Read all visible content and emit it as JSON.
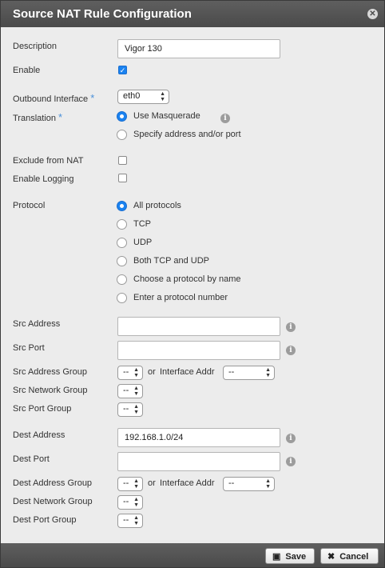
{
  "dialog": {
    "title": "Source NAT Rule Configuration",
    "close_icon": "close-icon"
  },
  "fields": {
    "description": {
      "label": "Description",
      "value": "Vigor 130"
    },
    "enable": {
      "label": "Enable",
      "checked": true
    },
    "outbound_interface": {
      "label": "Outbound Interface",
      "value": "eth0"
    },
    "translation": {
      "label": "Translation",
      "options": [
        "Use Masquerade",
        "Specify address and/or port"
      ],
      "selected": "Use Masquerade"
    },
    "exclude_from_nat": {
      "label": "Exclude from NAT",
      "checked": false
    },
    "enable_logging": {
      "label": "Enable Logging",
      "checked": false
    },
    "protocol": {
      "label": "Protocol",
      "options": [
        "All protocols",
        "TCP",
        "UDP",
        "Both TCP and UDP",
        "Choose a protocol by name",
        "Enter a protocol number"
      ],
      "selected": "All protocols"
    },
    "src_address": {
      "label": "Src Address",
      "value": ""
    },
    "src_port": {
      "label": "Src Port",
      "value": ""
    },
    "src_address_group": {
      "label": "Src Address Group",
      "value": "--",
      "or": "or",
      "iface_label": "Interface Addr",
      "iface_value": "--"
    },
    "src_network_group": {
      "label": "Src Network Group",
      "value": "--"
    },
    "src_port_group": {
      "label": "Src Port Group",
      "value": "--"
    },
    "dest_address": {
      "label": "Dest Address",
      "value": "192.168.1.0/24"
    },
    "dest_port": {
      "label": "Dest Port",
      "value": ""
    },
    "dest_address_group": {
      "label": "Dest Address Group",
      "value": "--",
      "or": "or",
      "iface_label": "Interface Addr",
      "iface_value": "--"
    },
    "dest_network_group": {
      "label": "Dest Network Group",
      "value": "--"
    },
    "dest_port_group": {
      "label": "Dest Port Group",
      "value": "--"
    }
  },
  "footer": {
    "save_label": "Save",
    "cancel_label": "Cancel"
  },
  "colors": {
    "accent": "#1a82f0",
    "titlebar": "#4f4f4f",
    "required": "#4a90d9"
  }
}
